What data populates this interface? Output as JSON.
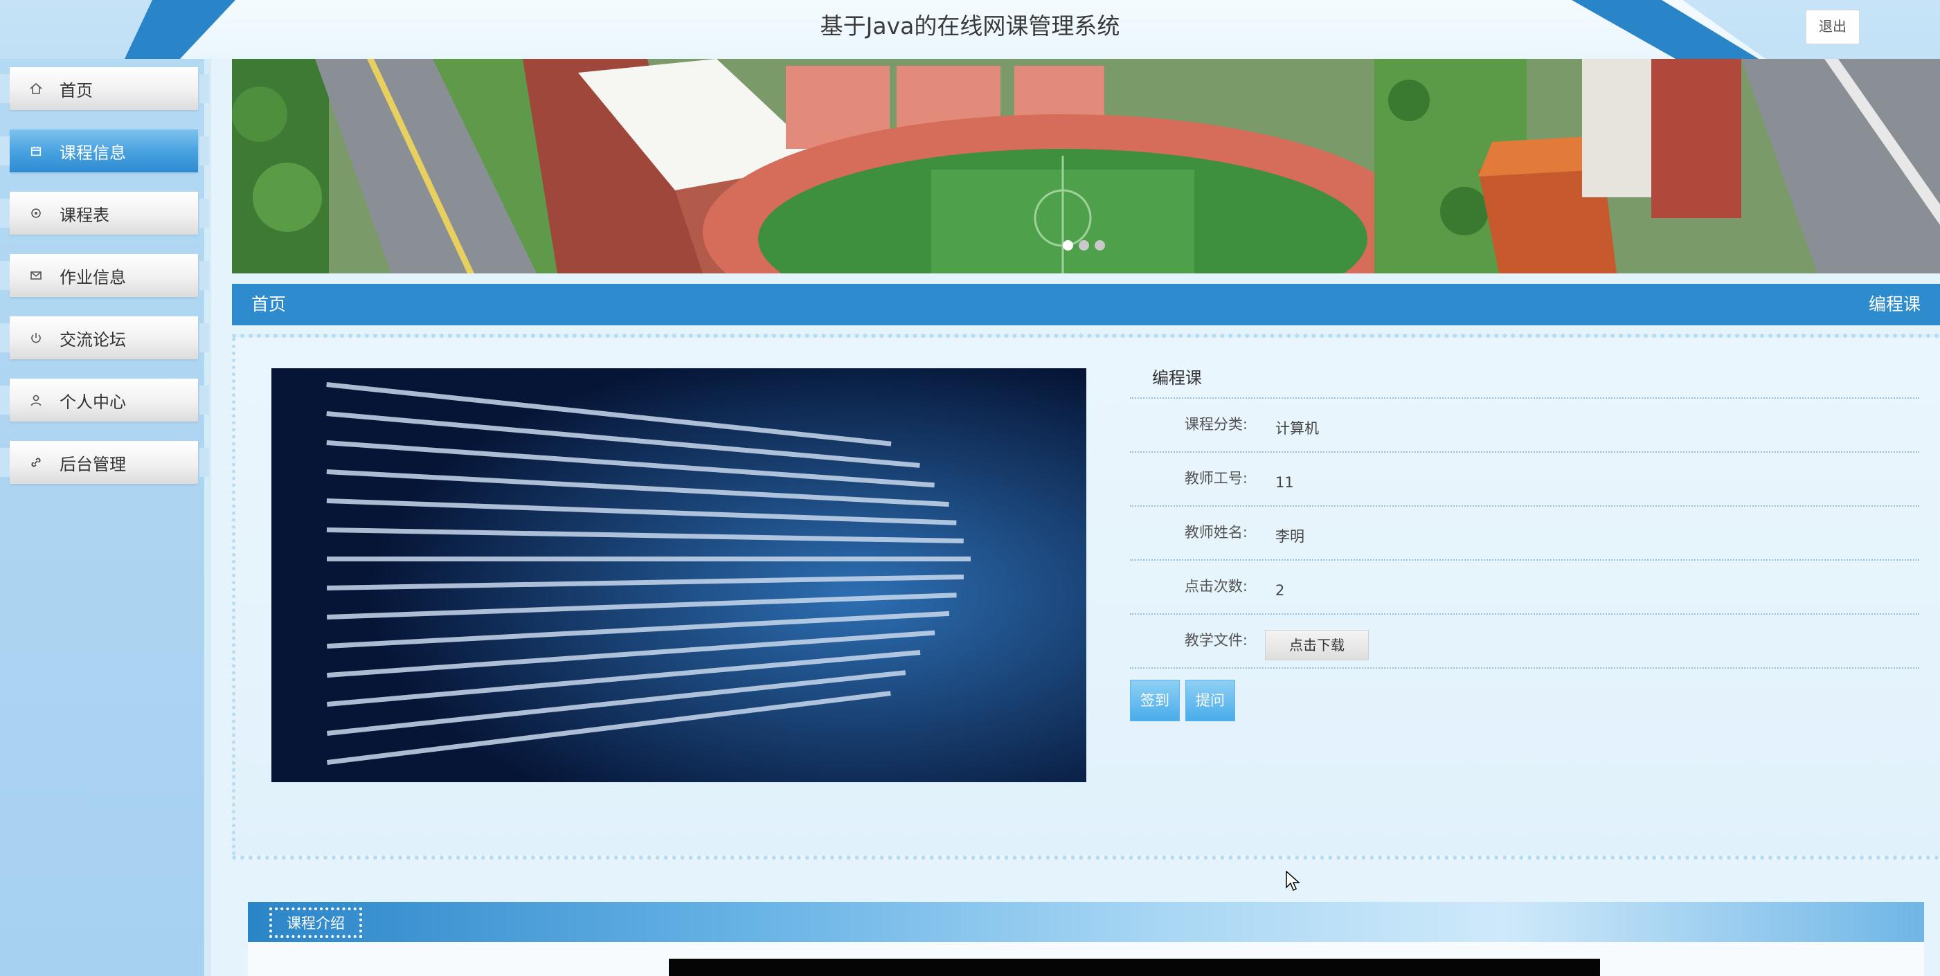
{
  "header": {
    "title": "基于Java的在线网课管理系统",
    "logout_label": "退出"
  },
  "sidebar": {
    "items": [
      {
        "label": "首页",
        "icon": "home-icon",
        "active": false
      },
      {
        "label": "课程信息",
        "icon": "calendar-icon",
        "active": true
      },
      {
        "label": "课程表",
        "icon": "gear-icon",
        "active": false
      },
      {
        "label": "作业信息",
        "icon": "mail-icon",
        "active": false
      },
      {
        "label": "交流论坛",
        "icon": "power-icon",
        "active": false
      },
      {
        "label": "个人中心",
        "icon": "user-icon",
        "active": false
      },
      {
        "label": "后台管理",
        "icon": "link-icon",
        "active": false
      }
    ]
  },
  "banner": {
    "slides": 3,
    "active_slide": 1
  },
  "breadcrumb": {
    "home": "首页",
    "current": "编程课"
  },
  "course": {
    "title": "编程课",
    "fields": [
      {
        "label": "课程分类:",
        "value": "计算机"
      },
      {
        "label": "教师工号:",
        "value": "11"
      },
      {
        "label": "教师姓名:",
        "value": "李明"
      },
      {
        "label": "点击次数:",
        "value": "2"
      }
    ],
    "file_label": "教学文件:",
    "download_label": "点击下载"
  },
  "actions": {
    "signin_label": "签到",
    "question_label": "提问"
  },
  "intro": {
    "tab_label": "课程介绍"
  },
  "colors": {
    "primary": "#2e8bce",
    "sidebar_bg": "#a6d1f0",
    "active_nav": "#4aa3e0",
    "button_blue": "#49acea"
  }
}
